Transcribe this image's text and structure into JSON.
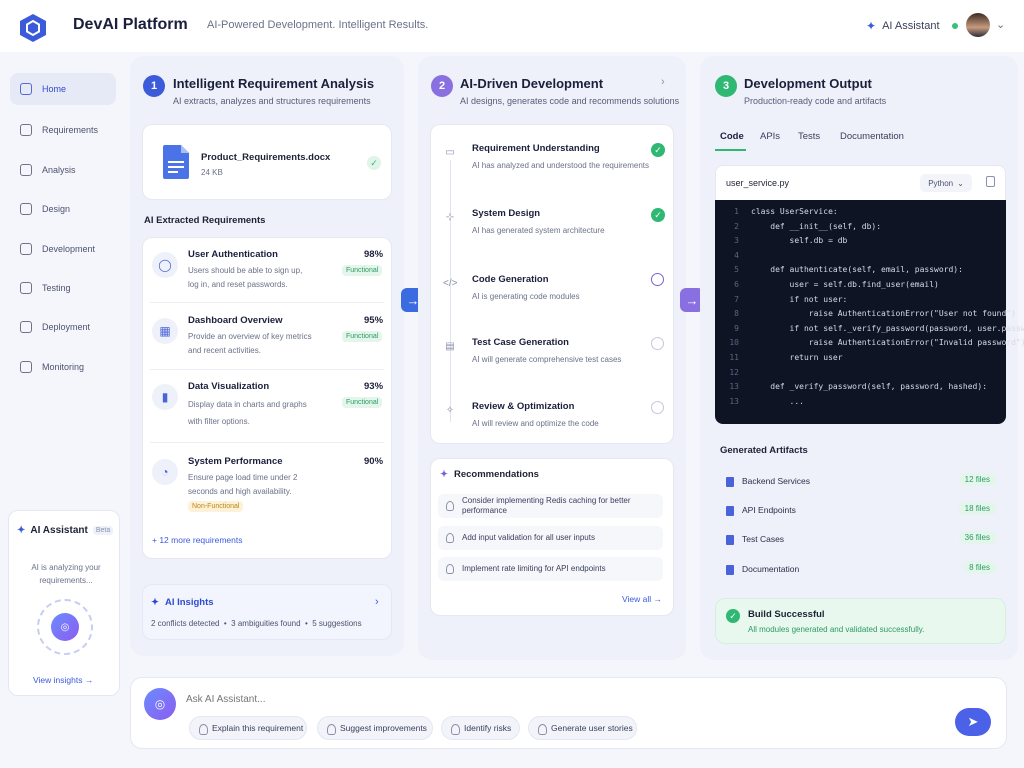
{
  "header": {
    "brand": "DevAI Platform",
    "tagline": "AI-Powered Development. Intelligent Results.",
    "assistant_label": "AI Assistant"
  },
  "sidebar": {
    "items": [
      {
        "label": "Home",
        "icon": "home-icon",
        "active": true
      },
      {
        "label": "Requirements",
        "icon": "document-icon"
      },
      {
        "label": "Analysis",
        "icon": "analysis-icon"
      },
      {
        "label": "Design",
        "icon": "design-icon"
      },
      {
        "label": "Development",
        "icon": "code-icon"
      },
      {
        "label": "Testing",
        "icon": "test-icon"
      },
      {
        "label": "Deployment",
        "icon": "rocket-icon"
      },
      {
        "label": "Monitoring",
        "icon": "monitor-icon"
      }
    ],
    "ai_card": {
      "title": "AI Assistant",
      "badge": "Beta",
      "status": "AI is analyzing your requirements...",
      "link": "View insights →"
    }
  },
  "column1": {
    "step": "1",
    "title": "Intelligent Requirement Analysis",
    "subtitle": "AI extracts, analyzes and structures requirements",
    "file": {
      "name": "Product_Requirements.docx",
      "size": "24 KB"
    },
    "section_title": "AI Extracted Requirements",
    "requirements": [
      {
        "title": "User Authentication",
        "desc1": "Users should be able to sign up,",
        "desc2": "log in, and reset passwords.",
        "pct": "98%",
        "tag": "Functional"
      },
      {
        "title": "Dashboard Overview",
        "desc1": "Provide an overview of key metrics",
        "desc2": "and recent activities.",
        "pct": "95%",
        "tag": "Functional"
      },
      {
        "title": "Data Visualization",
        "desc1": "Display data in charts and graphs",
        "desc2": "with filter options.",
        "pct": "93%",
        "tag": "Functional"
      },
      {
        "title": "System Performance",
        "desc1": "Ensure page load time under 2",
        "desc2": "seconds and high availability.",
        "pct": "90%",
        "tag": "Non-Functional"
      }
    ],
    "more": "+ 12 more requirements",
    "insights": {
      "title": "AI Insights",
      "summary": "2 conflicts detected  •  3 ambiguities found  •  5 suggestions"
    }
  },
  "column2": {
    "step": "2",
    "title": "AI-Driven Development",
    "subtitle": "AI designs, generates code and recommends solutions",
    "steps": [
      {
        "title": "Requirement Understanding",
        "desc": "AI has analyzed and understood the requirements",
        "status": "done"
      },
      {
        "title": "System Design",
        "desc": "AI has generated system architecture",
        "status": "done"
      },
      {
        "title": "Code Generation",
        "desc": "AI is generating code modules",
        "status": "active"
      },
      {
        "title": "Test Case Generation",
        "desc": "AI will generate comprehensive test cases",
        "status": "pending"
      },
      {
        "title": "Review & Optimization",
        "desc": "AI will review and optimize the code",
        "status": "pending"
      }
    ],
    "recommendations_title": "Recommendations",
    "recommendations": [
      "Consider implementing Redis caching for better performance",
      "Add input validation for all user inputs",
      "Implement rate limiting for API endpoints"
    ],
    "view_all": "View all →"
  },
  "column3": {
    "step": "3",
    "title": "Development Output",
    "subtitle": "Production-ready code and artifacts",
    "tabs": [
      "Code",
      "APIs",
      "Tests",
      "Documentation"
    ],
    "filename": "user_service.py",
    "language": "Python",
    "code": [
      "class UserService:",
      "    def __init__(self, db):",
      "        self.db = db",
      "",
      "    def authenticate(self, email, password):",
      "        user = self.db.find_user(email)",
      "        if not user:",
      "            raise AuthenticationError(\"User not found\")",
      "        if not self._verify_password(password, user.password):",
      "            raise AuthenticationError(\"Invalid password\")",
      "        return user",
      "",
      "    def _verify_password(self, password, hashed):",
      "        ..."
    ],
    "artifacts_title": "Generated Artifacts",
    "artifacts": [
      {
        "name": "Backend Services",
        "count": "12 files"
      },
      {
        "name": "API Endpoints",
        "count": "18 files"
      },
      {
        "name": "Test Cases",
        "count": "36 files"
      },
      {
        "name": "Documentation",
        "count": "8 files"
      }
    ],
    "build": {
      "title": "Build Successful",
      "desc": "All modules generated and validated successfully."
    }
  },
  "chat": {
    "placeholder": "Ask AI Assistant...",
    "chips": [
      "Explain this requirement",
      "Suggest improvements",
      "Identify risks",
      "Generate user stories"
    ]
  },
  "colors": {
    "accent": "#3b5bdb",
    "purple": "#7a62d9",
    "green": "#2fb872"
  }
}
